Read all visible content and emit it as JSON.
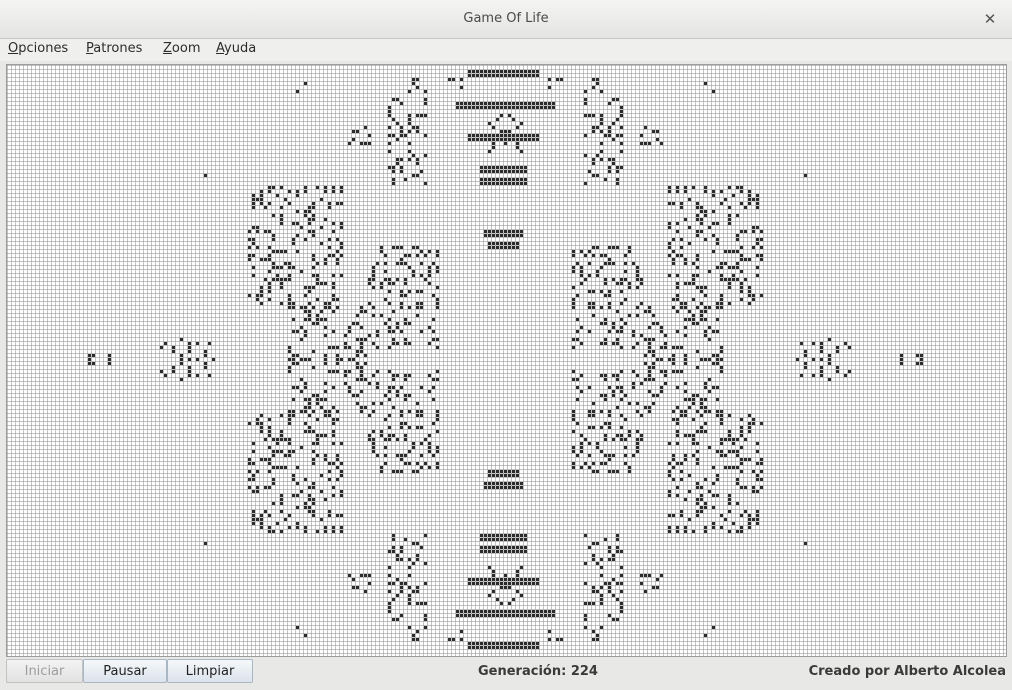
{
  "window": {
    "title": "Game Of Life"
  },
  "menu": [
    {
      "label": "Opciones",
      "mnemonic": "O"
    },
    {
      "label": "Patrones",
      "mnemonic": "P"
    },
    {
      "label": "Zoom",
      "mnemonic": "Z"
    },
    {
      "label": "Ayuda",
      "mnemonic": "A"
    }
  ],
  "buttons": {
    "start": {
      "label": "Iniciar",
      "enabled": false
    },
    "pause": {
      "label": "Pausar",
      "enabled": true
    },
    "clear": {
      "label": "Limpiar",
      "enabled": true
    }
  },
  "status": {
    "generation_label": "Generación: 224"
  },
  "footer": {
    "credit": "Creado por Alberto Alcolea"
  },
  "icons": {
    "close": "close-icon"
  },
  "colors": {
    "grid_line": "#8a8a8a",
    "cell_alive": "#2b2b2b",
    "cell_dead": "#ffffff",
    "accent_button": "#dbe3ec"
  }
}
